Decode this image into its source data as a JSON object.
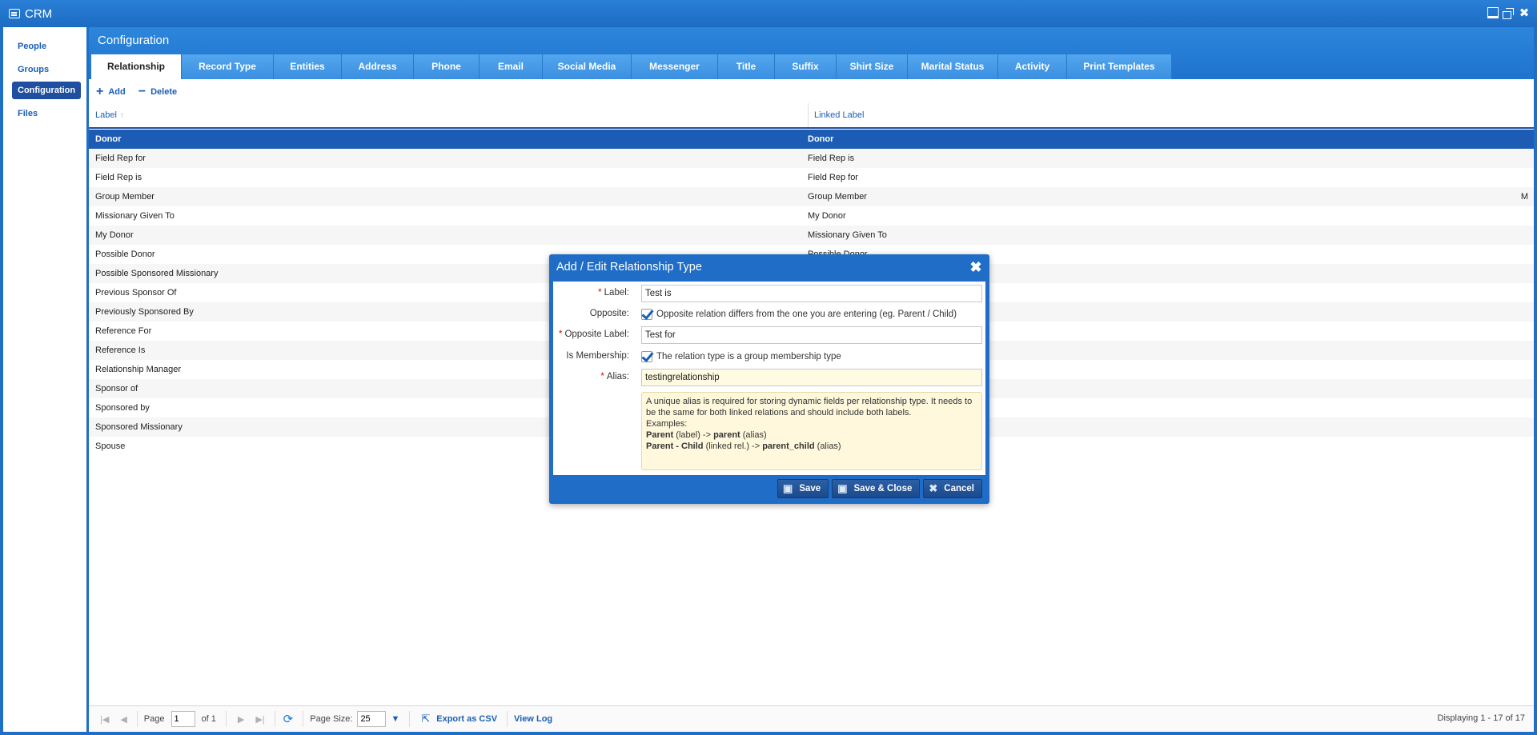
{
  "window": {
    "title": "CRM"
  },
  "sidebar": {
    "items": [
      {
        "label": "People",
        "active": false
      },
      {
        "label": "Groups",
        "active": false
      },
      {
        "label": "Configuration",
        "active": true
      },
      {
        "label": "Files",
        "active": false
      }
    ]
  },
  "panel": {
    "title": "Configuration",
    "tabs": [
      {
        "label": "Relationship",
        "active": true
      },
      {
        "label": "Record Type"
      },
      {
        "label": "Entities"
      },
      {
        "label": "Address"
      },
      {
        "label": "Phone"
      },
      {
        "label": "Email"
      },
      {
        "label": "Social Media"
      },
      {
        "label": "Messenger"
      },
      {
        "label": "Title"
      },
      {
        "label": "Suffix"
      },
      {
        "label": "Shirt Size"
      },
      {
        "label": "Marital Status"
      },
      {
        "label": "Activity"
      },
      {
        "label": "Print Templates"
      }
    ]
  },
  "toolbar": {
    "add_label": "Add",
    "delete_label": "Delete"
  },
  "grid": {
    "columns": [
      "Label",
      "Linked Label"
    ],
    "rows": [
      {
        "label": "Donor",
        "linked": "Donor",
        "extra": "",
        "selected": true
      },
      {
        "label": "Field Rep for",
        "linked": "Field Rep is",
        "extra": ""
      },
      {
        "label": "Field Rep is",
        "linked": "Field Rep for",
        "extra": ""
      },
      {
        "label": "Group Member",
        "linked": "Group Member",
        "extra": "M"
      },
      {
        "label": "Missionary Given To",
        "linked": "My Donor",
        "extra": ""
      },
      {
        "label": "My Donor",
        "linked": "Missionary Given To",
        "extra": ""
      },
      {
        "label": "Possible Donor",
        "linked": "Possible Donor",
        "extra": ""
      },
      {
        "label": "Possible Sponsored Missionary",
        "linked": "",
        "extra": ""
      },
      {
        "label": "Previous Sponsor Of",
        "linked": "",
        "extra": ""
      },
      {
        "label": "Previously Sponsored By",
        "linked": "",
        "extra": ""
      },
      {
        "label": "Reference For",
        "linked": "",
        "extra": ""
      },
      {
        "label": "Reference Is",
        "linked": "",
        "extra": ""
      },
      {
        "label": "Relationship Manager",
        "linked": "",
        "extra": ""
      },
      {
        "label": "Sponsor of",
        "linked": "",
        "extra": ""
      },
      {
        "label": "Sponsored by",
        "linked": "",
        "extra": ""
      },
      {
        "label": "Sponsored Missionary",
        "linked": "",
        "extra": ""
      },
      {
        "label": "Spouse",
        "linked": "",
        "extra": ""
      }
    ]
  },
  "footer": {
    "page_label": "Page",
    "page_value": "1",
    "of_label": "of 1",
    "page_size_label": "Page Size:",
    "page_size_value": "25",
    "export_label": "Export as CSV",
    "view_log_label": "View Log",
    "displaying": "Displaying 1 - 17 of 17"
  },
  "dialog": {
    "title": "Add / Edit Relationship Type",
    "label_label": "Label:",
    "label_value": "Test is",
    "opposite_label": "Opposite:",
    "opposite_text": "Opposite relation differs from the one you are entering (eg. Parent / Child)",
    "opposite_checked": true,
    "opposite_label_label": "Opposite Label:",
    "opposite_label_value": "Test for",
    "membership_label": "Is Membership:",
    "membership_text": "The relation type is a group membership type",
    "membership_checked": true,
    "alias_label": "Alias:",
    "alias_value": "testingrelationship",
    "help": {
      "line1": "A unique alias is required for storing dynamic fields per relationship type. It needs to be the same for both linked relations and should include both labels.",
      "examples": "Examples:",
      "ex1_bold": "Parent",
      "ex1_mid": " (label) -> ",
      "ex1_bold2": "parent",
      "ex1_end": " (alias)",
      "ex2_bold": "Parent - Child",
      "ex2_mid": " (linked rel.) -> ",
      "ex2_bold2": "parent_child",
      "ex2_end": " (alias)"
    },
    "save_label": "Save",
    "save_close_label": "Save & Close",
    "cancel_label": "Cancel"
  }
}
